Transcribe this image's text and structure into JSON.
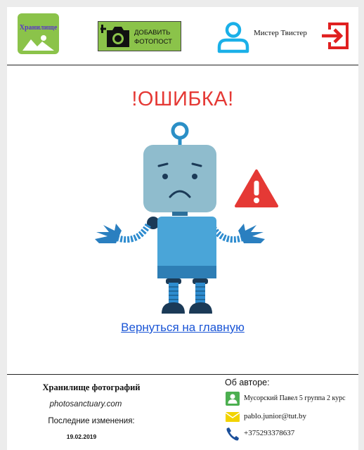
{
  "header": {
    "logo_text": "Хранилище",
    "add_button_line1": "ДОБАВИТЬ",
    "add_button_line2": "ФОТОПОСТ",
    "user_name": "Мистер Твистер"
  },
  "main": {
    "error_title": "!ОШИБКА!",
    "back_link": "Вернуться на главную"
  },
  "footer": {
    "title": "Хранилище фотографий",
    "site": "photosanctuary.com",
    "updated_label": "Последние изменения:",
    "updated_date": "19.02.2019",
    "about_label": "Об авторе:",
    "author": "Мусорский Павел 5 группа 2 курс",
    "email": "pablo.junior@tut.by",
    "phone": "+375293378637"
  },
  "colors": {
    "accent_green": "#8bc34a",
    "error_red": "#e53935",
    "link_blue": "#1a55d6",
    "user_cyan": "#1ab0e8",
    "logout_red": "#e02020"
  },
  "icons": {
    "logo": "mountain-image-icon",
    "add_photo": "camera-plus-icon",
    "user": "user-icon",
    "logout": "logout-icon",
    "warning": "warning-icon",
    "author": "contact-card-icon",
    "email": "envelope-icon",
    "phone": "phone-icon"
  }
}
